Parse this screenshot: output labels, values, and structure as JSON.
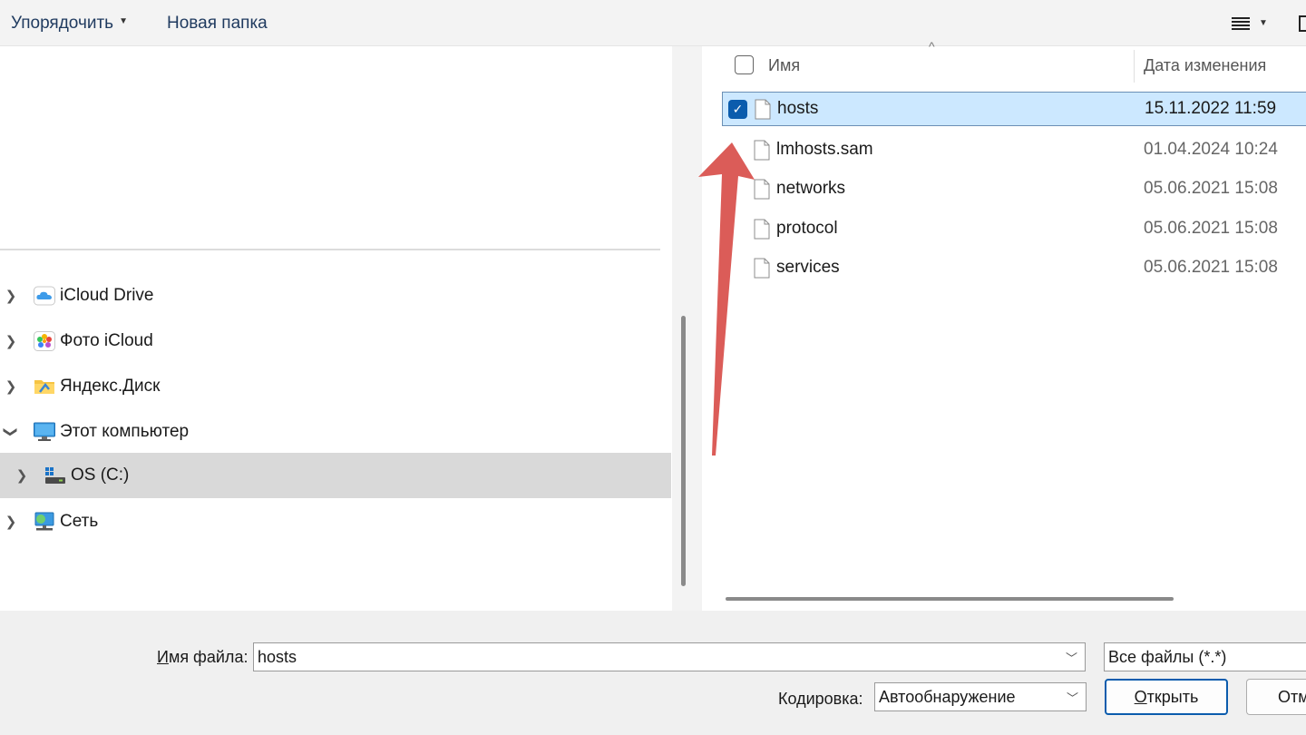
{
  "toolbar": {
    "organize_label": "Упорядочить",
    "new_folder_label": "Новая папка"
  },
  "nav": {
    "items": [
      {
        "label": "iCloud Drive",
        "icon": "cloud-icon",
        "expanded": false
      },
      {
        "label": "Фото iCloud",
        "icon": "photos-icon",
        "expanded": false
      },
      {
        "label": "Яндекс.Диск",
        "icon": "folder-icon",
        "expanded": false
      },
      {
        "label": "Этот компьютер",
        "icon": "computer-icon",
        "expanded": true
      },
      {
        "label": "OS (C:)",
        "icon": "drive-icon",
        "expanded": false,
        "selected": true
      },
      {
        "label": "Сеть",
        "icon": "network-icon",
        "expanded": false
      }
    ]
  },
  "file_list": {
    "columns": {
      "name": "Имя",
      "date": "Дата изменения"
    },
    "rows": [
      {
        "name": "hosts",
        "date": "15.11.2022 11:59",
        "selected": true
      },
      {
        "name": "lmhosts.sam",
        "date": "01.04.2024 10:24",
        "selected": false
      },
      {
        "name": "networks",
        "date": "05.06.2021 15:08",
        "selected": false
      },
      {
        "name": "protocol",
        "date": "05.06.2021 15:08",
        "selected": false
      },
      {
        "name": "services",
        "date": "05.06.2021 15:08",
        "selected": false
      }
    ]
  },
  "bottom": {
    "filename_label_accel": "И",
    "filename_label_rest": "мя файла:",
    "filename_value": "hosts",
    "filetype_value": "Все файлы  (*.*)",
    "encoding_label": "Кодировка:",
    "encoding_value": "Автообнаружение",
    "open_accel": "О",
    "open_rest": "ткрыть",
    "cancel_label": "Отм"
  },
  "colors": {
    "selection_bg": "#cce8ff",
    "checkbox_fill": "#0b5cad",
    "arrow": "#d9534f"
  }
}
